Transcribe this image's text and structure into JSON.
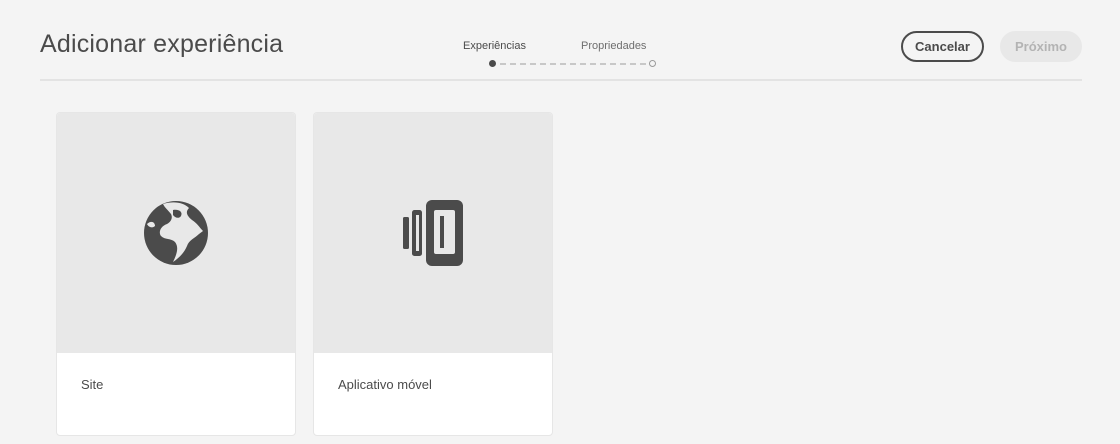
{
  "header": {
    "title": "Adicionar experiência"
  },
  "stepper": {
    "steps": [
      {
        "label": "Experiências",
        "state": "active"
      },
      {
        "label": "Propriedades",
        "state": "inactive"
      }
    ]
  },
  "actions": {
    "cancel_label": "Cancelar",
    "next_label": "Próximo"
  },
  "cards": [
    {
      "label": "Site",
      "icon": "globe-icon"
    },
    {
      "label": "Aplicativo móvel",
      "icon": "mobile-app-icon"
    }
  ],
  "colors": {
    "background": "#f4f4f4",
    "text": "#4b4b4b",
    "thumbnail": "#e8e8e8",
    "disabled_button": "#e8e8e8",
    "disabled_text": "#b3b3b3"
  }
}
